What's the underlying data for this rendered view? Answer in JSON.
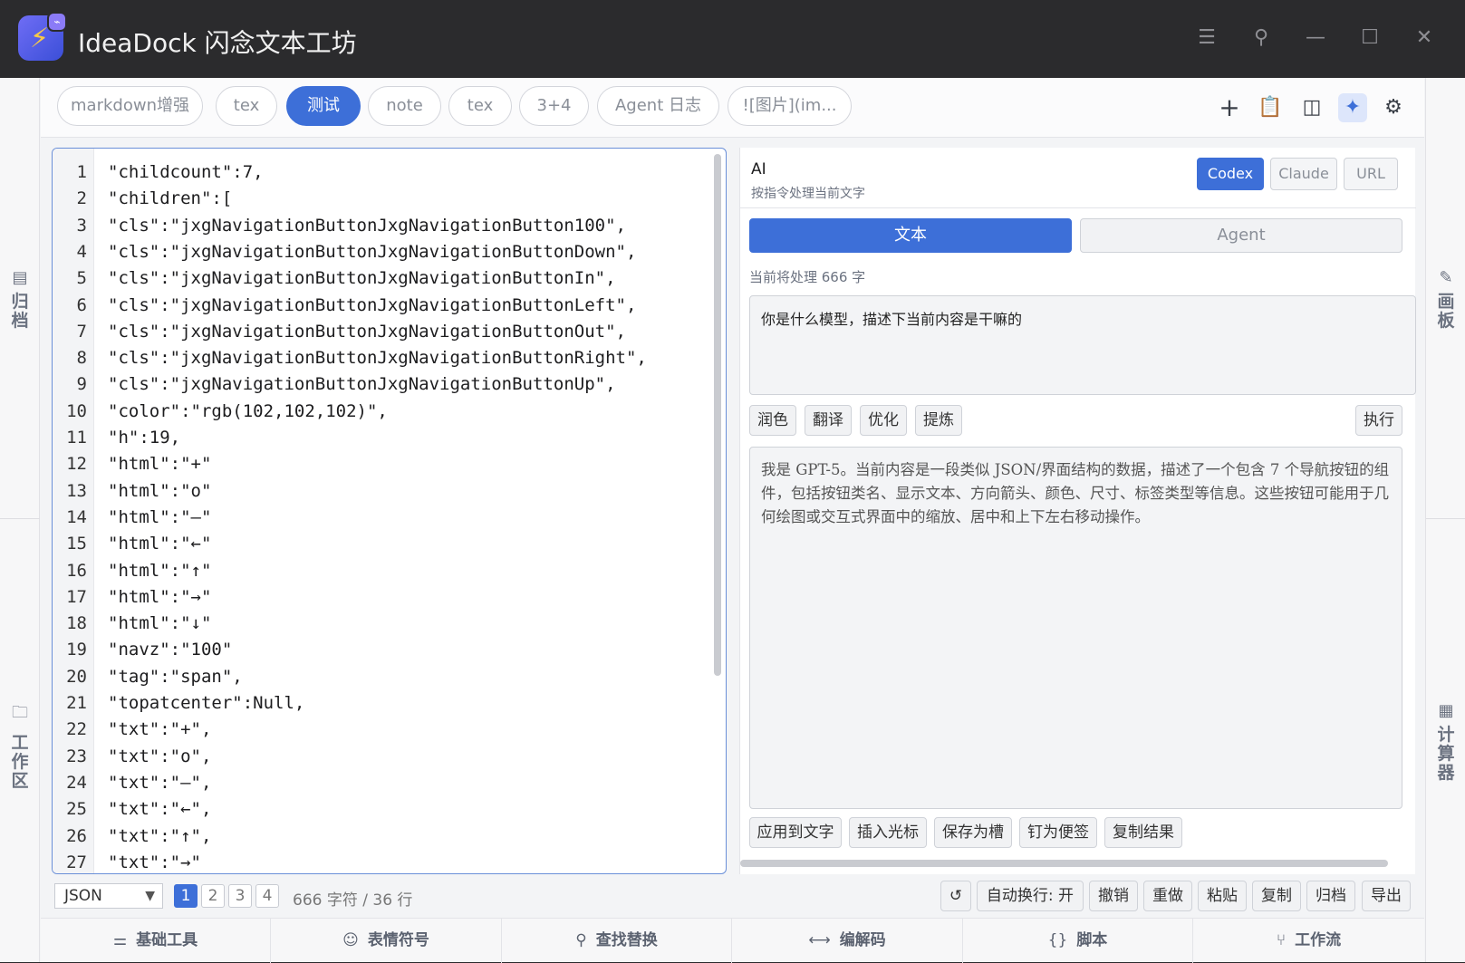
{
  "app": {
    "title": "IdeaDock 闪念文本工坊",
    "logo_icon": "bolt-plug-icon"
  },
  "window_controls": [
    "menu-icon",
    "pin-icon",
    "minimize-icon",
    "maximize-icon",
    "close-icon"
  ],
  "rails": {
    "left": [
      {
        "icon": "archive-box-icon",
        "label": "归档"
      },
      {
        "icon": "folder-icon",
        "label": "工作区"
      }
    ],
    "right": [
      {
        "icon": "pen-icon",
        "label": "画板"
      },
      {
        "icon": "calculator-icon",
        "label": "计算器"
      }
    ]
  },
  "tabs": [
    {
      "label": "markdown增强",
      "active": false
    },
    {
      "label": "tex",
      "active": false
    },
    {
      "label": "测试",
      "active": true
    },
    {
      "label": "note",
      "active": false
    },
    {
      "label": "tex",
      "active": false
    },
    {
      "label": "3+4",
      "active": false
    },
    {
      "label": "Agent 日志",
      "active": false
    },
    {
      "label": "![图片](im...",
      "active": false
    }
  ],
  "toolbar_icons": [
    "plus-icon",
    "clipboard-icon",
    "split-view-icon",
    "ai-sparkle-icon",
    "settings-gear-icon"
  ],
  "editor": {
    "lines": [
      "\"childcount\":7,",
      "\"children\":[",
      "\"cls\":\"jxgNavigationButtonJxgNavigationButton100\",",
      "\"cls\":\"jxgNavigationButtonJxgNavigationButtonDown\",",
      "\"cls\":\"jxgNavigationButtonJxgNavigationButtonIn\",",
      "\"cls\":\"jxgNavigationButtonJxgNavigationButtonLeft\",",
      "\"cls\":\"jxgNavigationButtonJxgNavigationButtonOut\",",
      "\"cls\":\"jxgNavigationButtonJxgNavigationButtonRight\",",
      "\"cls\":\"jxgNavigationButtonJxgNavigationButtonUp\",",
      "\"color\":\"rgb(102,102,102)\",",
      "\"h\":19,",
      "\"html\":\"+\"",
      "\"html\":\"o\"",
      "\"html\":\"–\"",
      "\"html\":\"←\"",
      "\"html\":\"↑\"",
      "\"html\":\"→\"",
      "\"html\":\"↓\"",
      "\"navz\":\"100\"",
      "\"tag\":\"span\",",
      "\"topatcenter\":Null,",
      "\"txt\":\"+\",",
      "\"txt\":\"o\",",
      "\"txt\":\"–\",",
      "\"txt\":\"←\",",
      "\"txt\":\"↑\",",
      "\"txt\":\"→\""
    ]
  },
  "status": {
    "language": "JSON",
    "pages": [
      "1",
      "2",
      "3",
      "4"
    ],
    "active_page": "1",
    "char_count": "666 字符 / 36 行",
    "buttons": [
      "自动换行: 开",
      "撤销",
      "重做",
      "粘贴",
      "复制",
      "归档",
      "导出"
    ],
    "refresh_icon": "refresh-icon"
  },
  "ai_panel": {
    "title": "AI",
    "subtitle": "按指令处理当前文字",
    "providers": [
      {
        "label": "Codex",
        "active": true
      },
      {
        "label": "Claude",
        "active": false
      },
      {
        "label": "URL",
        "active": false
      }
    ],
    "modes": {
      "text": "文本",
      "agent": "Agent"
    },
    "pending_info": "当前将处理 666 字",
    "prompt": "你是什么模型，描述下当前内容是干嘛的",
    "actions": [
      "润色",
      "翻译",
      "优化",
      "提炼"
    ],
    "execute_label": "执行",
    "result": "我是 GPT-5。当前内容是一段类似 JSON/界面结构的数据，描述了一个包含 7 个导航按钮的组件，包括按钮类名、显示文本、方向箭头、颜色、尺寸、标签类型等信息。这些按钮可能用于几何绘图或交互式界面中的缩放、居中和上下左右移动操作。",
    "result_buttons": [
      "应用到文字",
      "插入光标",
      "保存为槽",
      "钉为便签",
      "复制结果"
    ]
  },
  "bottom_tabs": [
    {
      "icon": "sliders-icon",
      "label": "基础工具"
    },
    {
      "icon": "smiley-icon",
      "label": "表情符号"
    },
    {
      "icon": "search-person-icon",
      "label": "查找替换"
    },
    {
      "icon": "arrows-lr-icon",
      "label": "编解码"
    },
    {
      "icon": "braces-icon",
      "label": "脚本"
    },
    {
      "icon": "workflow-icon",
      "label": "工作流"
    }
  ]
}
